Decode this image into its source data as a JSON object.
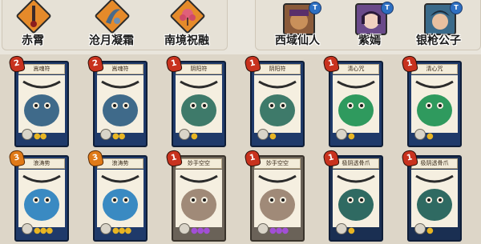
{
  "relics": [
    {
      "label": "赤霄",
      "color": "#e58a2a"
    },
    {
      "label": "沧月凝霜",
      "color": "#e58a2a"
    },
    {
      "label": "南境祝融",
      "color": "#e58a2a"
    }
  ],
  "characters": [
    {
      "label": "西域仙人",
      "badge": "T"
    },
    {
      "label": "紫嫣",
      "badge": "T"
    },
    {
      "label": "银枪公子",
      "badge": "T"
    }
  ],
  "cards_row1": [
    {
      "title": "嵩魂符",
      "cost": "2",
      "pips": "●●",
      "theme": "blue",
      "art_color": "#3f6a8a"
    },
    {
      "title": "嵩魂符",
      "cost": "2",
      "pips": "●●",
      "theme": "blue",
      "art_color": "#3f6a8a"
    },
    {
      "title": "阴阳符",
      "cost": "1",
      "pips": "●",
      "theme": "blue",
      "art_color": "#3e7a6a"
    },
    {
      "title": "阴阳符",
      "cost": "1",
      "pips": "●",
      "theme": "blue",
      "art_color": "#3e7a6a"
    },
    {
      "title": "清心咒",
      "cost": "1",
      "pips": "●",
      "theme": "blue",
      "art_color": "#2f9a5e"
    },
    {
      "title": "清心咒",
      "cost": "1",
      "pips": "●",
      "theme": "blue",
      "art_color": "#2f9a5e"
    }
  ],
  "cards_row2": [
    {
      "title": "浪涛势",
      "cost": "3",
      "pips": "●●●",
      "theme": "blue",
      "art_color": "#3a8ac2"
    },
    {
      "title": "浪涛势",
      "cost": "3",
      "pips": "●●●",
      "theme": "blue",
      "art_color": "#3a8ac2"
    },
    {
      "title": "妙手空空",
      "cost": "1",
      "pips": "●●●",
      "theme": "grey",
      "art_color": "#a08a78"
    },
    {
      "title": "妙手空空",
      "cost": "1",
      "pips": "●●●",
      "theme": "grey",
      "art_color": "#a08a78"
    },
    {
      "title": "极阴透骨爪",
      "cost": "1",
      "pips": "●",
      "theme": "dark",
      "art_color": "#2f6a62"
    },
    {
      "title": "极阴透骨爪",
      "cost": "1",
      "pips": "●",
      "theme": "dark",
      "art_color": "#2f6a62"
    }
  ]
}
